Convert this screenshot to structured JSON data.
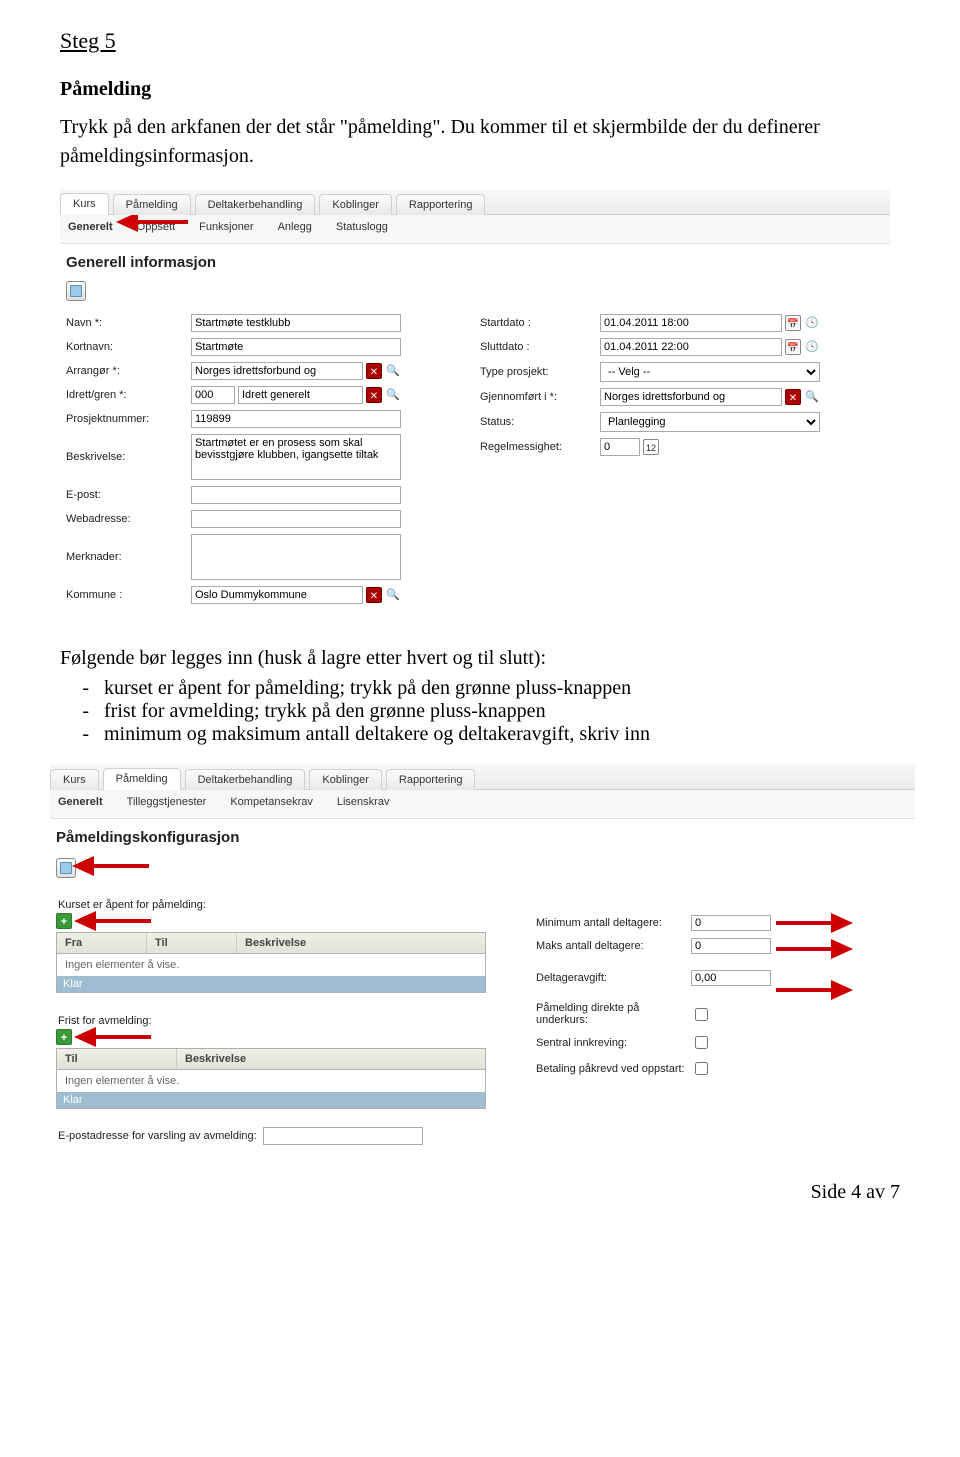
{
  "step": {
    "title": "Steg 5",
    "heading": "Påmelding",
    "intro": "Trykk på den arkfanen der det står \"påmelding\". Du kommer til et skjermbilde der du definerer påmeldingsinformasjon."
  },
  "midtext": {
    "para": "Følgende bør legges inn (husk å lagre etter hvert og til slutt):",
    "items": [
      "kurset er åpent for påmelding; trykk på den grønne pluss-knappen",
      "frist for avmelding; trykk på den grønne pluss-knappen",
      "minimum og maksimum antall deltakere og deltakeravgift, skriv inn"
    ]
  },
  "panel1": {
    "tabs": [
      "Kurs",
      "Påmelding",
      "Deltakerbehandling",
      "Koblinger",
      "Rapportering"
    ],
    "subtabs": [
      "Generelt",
      "Oppsett",
      "Funksjoner",
      "Anlegg",
      "Statuslogg"
    ],
    "section_title": "Generell informasjon",
    "left": {
      "navn_label": "Navn *:",
      "navn_value": "Startmøte testklubb",
      "kortnavn_label": "Kortnavn:",
      "kortnavn_value": "Startmøte",
      "arrangor_label": "Arrangør *:",
      "arrangor_value": "Norges idrettsforbund og",
      "idrett_label": "Idrett/gren *:",
      "idrett_code": "000",
      "idrett_value": "Idrett generelt",
      "prosjekt_label": "Prosjektnummer:",
      "prosjekt_value": "119899",
      "beskrivelse_label": "Beskrivelse:",
      "beskrivelse_value": "Startmøtet er en prosess som skal bevisstgjøre klubben, igangsette tiltak",
      "epost_label": "E-post:",
      "web_label": "Webadresse:",
      "merk_label": "Merknader:",
      "kommune_label": "Kommune :",
      "kommune_value": "Oslo Dummykommune"
    },
    "right": {
      "startdato_label": "Startdato :",
      "startdato_value": "01.04.2011 18:00",
      "sluttdato_label": "Sluttdato :",
      "sluttdato_value": "01.04.2011 22:00",
      "type_label": "Type prosjekt:",
      "type_value": "-- Velg --",
      "gjennomfort_label": "Gjennomført i *:",
      "gjennomfort_value": "Norges idrettsforbund og",
      "status_label": "Status:",
      "status_value": "Planlegging",
      "regel_label": "Regelmessighet:",
      "regel_value": "0"
    }
  },
  "panel2": {
    "tabs": [
      "Kurs",
      "Påmelding",
      "Deltakerbehandling",
      "Koblinger",
      "Rapportering"
    ],
    "subtabs": [
      "Generelt",
      "Tilleggstjenester",
      "Kompetansekrav",
      "Lisenskrav"
    ],
    "section_title": "Påmeldingskonfigurasjon",
    "openfor_label": "Kurset er åpent for påmelding:",
    "table1_headers": [
      "Fra",
      "Til",
      "Beskrivelse"
    ],
    "table1_empty": "Ingen elementer å vise.",
    "table_klar": "Klar",
    "frist_label": "Frist for avmelding:",
    "table2_headers": [
      "Til",
      "Beskrivelse"
    ],
    "table2_empty": "Ingen elementer å vise.",
    "epost_label": "E-postadresse for varsling av avmelding:",
    "right": {
      "min_label": "Minimum antall deltagere:",
      "min_value": "0",
      "maks_label": "Maks antall deltagere:",
      "maks_value": "0",
      "avgift_label": "Deltageravgift:",
      "avgift_value": "0,00",
      "direkte_label": "Påmelding direkte på underkurs:",
      "sentral_label": "Sentral innkreving:",
      "betaling_label": "Betaling påkrevd ved oppstart:"
    }
  },
  "footer": "Side 4 av 7"
}
